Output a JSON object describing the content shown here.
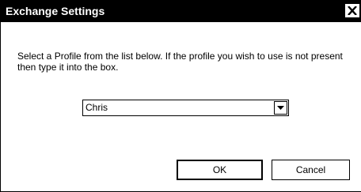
{
  "window": {
    "title": "Exchange Settings",
    "close_icon": "close-icon"
  },
  "message": "Select a Profile from the list below. If the profile you wish to use is not present then type it into the box.",
  "profile_combo": {
    "value": "Chris",
    "arrow_icon": "chevron-down-icon"
  },
  "buttons": {
    "ok_label": "OK",
    "cancel_label": "Cancel"
  }
}
